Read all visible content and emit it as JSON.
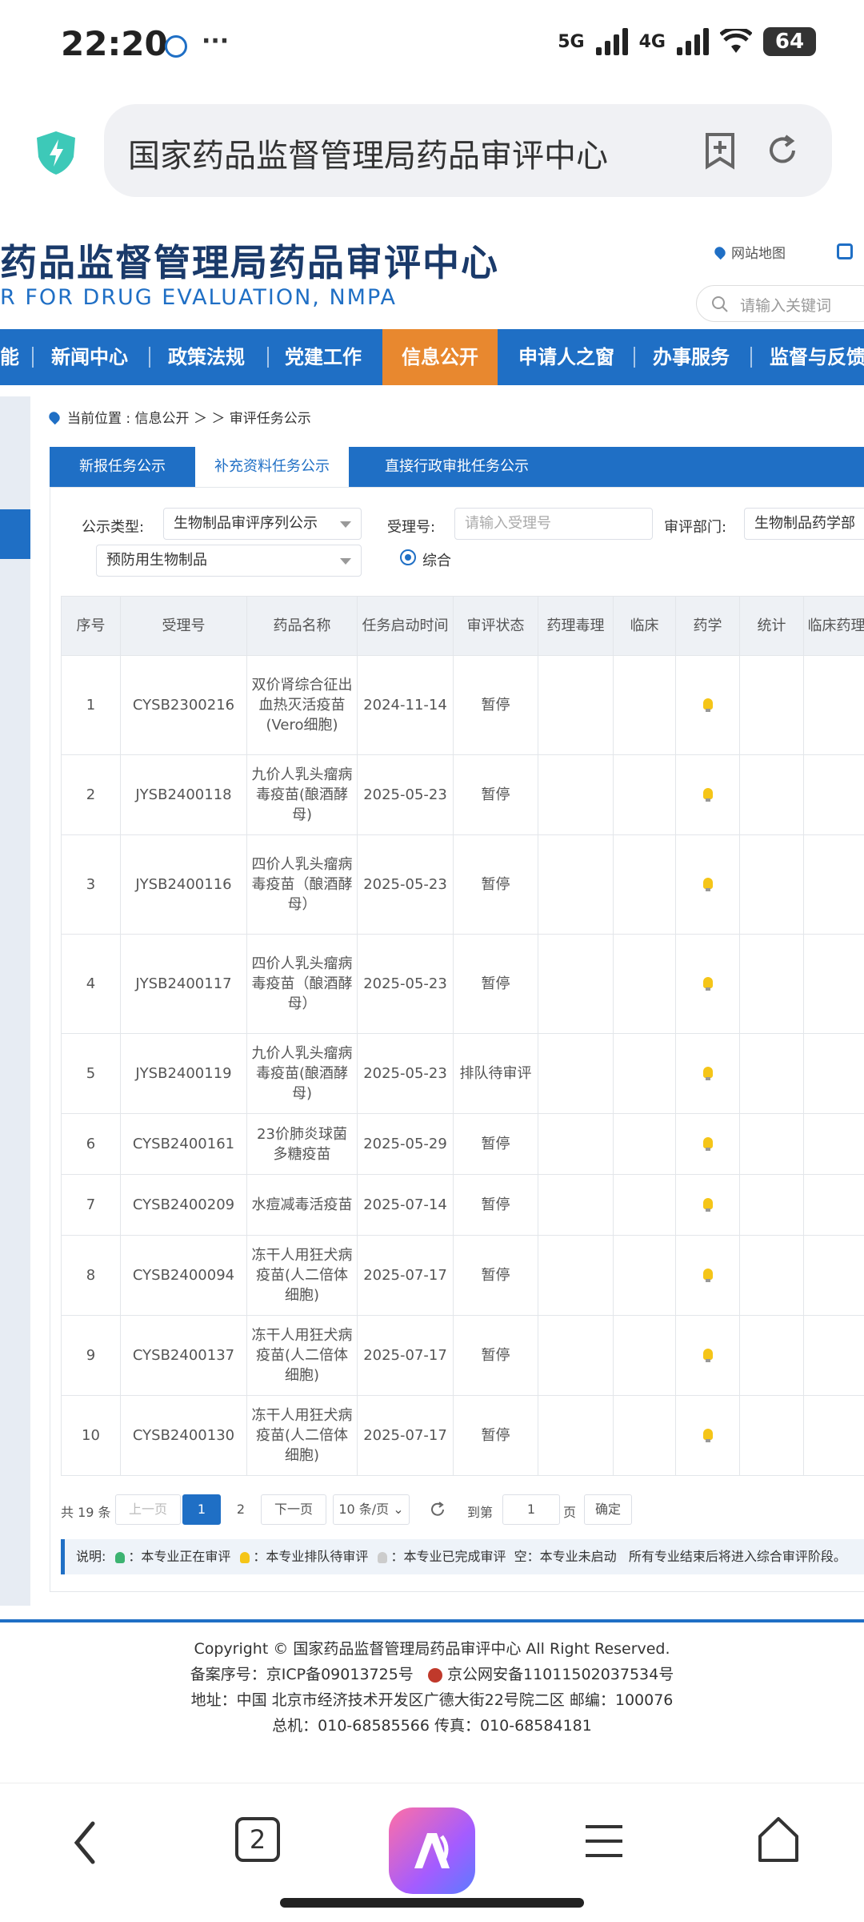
{
  "status": {
    "time": "22:20",
    "net1": "5G",
    "net2": "4G",
    "battery": "64"
  },
  "browser": {
    "url": "国家药品监督管理局药品审评中心",
    "tab_count": "2"
  },
  "site": {
    "title": "药品监督管理局药品审评中心",
    "subtitle": "R FOR DRUG EVALUATION, NMPA",
    "sitemap": "网站地图",
    "search_placeholder": "请输入关键词"
  },
  "nav": {
    "items": [
      {
        "label": "能"
      },
      {
        "label": "新闻中心"
      },
      {
        "label": "政策法规"
      },
      {
        "label": "党建工作"
      },
      {
        "label": "信息公开"
      },
      {
        "label": "申请人之窗"
      },
      {
        "label": "办事服务"
      },
      {
        "label": "监督与反馈"
      }
    ]
  },
  "breadcrumb": "当前位置 : 信息公开 ＞ ＞ 审评任务公示",
  "tabs": [
    {
      "label": "新报任务公示"
    },
    {
      "label": "补充资料任务公示"
    },
    {
      "label": "直接行政审批任务公示"
    }
  ],
  "filters": {
    "type_label": "公示类型:",
    "type_value": "生物制品审评序列公示",
    "accept_label": "受理号:",
    "accept_placeholder": "请输入受理号",
    "dept_label": "审评部门:",
    "dept_value": "生物制品药学部",
    "category_value": "预防用生物制品",
    "radio_label": "综合"
  },
  "table": {
    "headers": [
      "序号",
      "受理号",
      "药品名称",
      "任务启动时间",
      "审评状态",
      "药理毒理",
      "临床",
      "药学",
      "统计",
      "临床药理"
    ],
    "rows": [
      {
        "no": "1",
        "id": "CYSB2300216",
        "name": "双价肾综合征出血热灭活疫苗(Vero细胞)",
        "date": "2024-11-14",
        "status": "暂停"
      },
      {
        "no": "2",
        "id": "JYSB2400118",
        "name": "九价人乳头瘤病毒疫苗(酿酒酵母)",
        "date": "2025-05-23",
        "status": "暂停"
      },
      {
        "no": "3",
        "id": "JYSB2400116",
        "name": "四价人乳头瘤病毒疫苗（酿酒酵母）",
        "date": "2025-05-23",
        "status": "暂停"
      },
      {
        "no": "4",
        "id": "JYSB2400117",
        "name": "四价人乳头瘤病毒疫苗（酿酒酵母）",
        "date": "2025-05-23",
        "status": "暂停"
      },
      {
        "no": "5",
        "id": "JYSB2400119",
        "name": "九价人乳头瘤病毒疫苗(酿酒酵母)",
        "date": "2025-05-23",
        "status": "排队待审评"
      },
      {
        "no": "6",
        "id": "CYSB2400161",
        "name": "23价肺炎球菌多糖疫苗",
        "date": "2025-05-29",
        "status": "暂停"
      },
      {
        "no": "7",
        "id": "CYSB2400209",
        "name": "水痘减毒活疫苗",
        "date": "2025-07-14",
        "status": "暂停"
      },
      {
        "no": "8",
        "id": "CYSB2400094",
        "name": "冻干人用狂犬病疫苗(人二倍体细胞)",
        "date": "2025-07-17",
        "status": "暂停"
      },
      {
        "no": "9",
        "id": "CYSB2400137",
        "name": "冻干人用狂犬病疫苗(人二倍体细胞)",
        "date": "2025-07-17",
        "status": "暂停"
      },
      {
        "no": "10",
        "id": "CYSB2400130",
        "name": "冻干人用狂犬病疫苗(人二倍体细胞)",
        "date": "2025-07-17",
        "status": "暂停"
      }
    ]
  },
  "pagination": {
    "total": "共 19 条",
    "prev": "上一页",
    "page1": "1",
    "page2": "2",
    "next": "下一页",
    "per_page": "10 条/页",
    "goto_label": "到第",
    "goto_value": "1",
    "page_unit": "页",
    "confirm": "确定"
  },
  "legend": {
    "title": "说明:",
    "green": "：本专业正在审评",
    "yellow": "：本专业排队待审评",
    "gray": "：本专业已完成审评",
    "empty": "空：本专业未启动",
    "note": "所有专业结束后将进入综合审评阶段。",
    "colors": {
      "green": "#3cb371",
      "yellow": "#f5c518",
      "gray": "#cccccc"
    }
  },
  "footer": {
    "copyright": "Copyright © 国家药品监督管理局药品审评中心   All Right Reserved.",
    "icp": "备案序号：京ICP备09013725号",
    "police": "京公网安备11011502037534号",
    "address": "地址：中国 北京市经济技术开发区广德大街22号院二区      邮编：100076",
    "phone": "总机：010-68585566      传真：010-68584181"
  },
  "colors": {
    "primary": "#1f6fc5",
    "accent": "#e8882f"
  }
}
